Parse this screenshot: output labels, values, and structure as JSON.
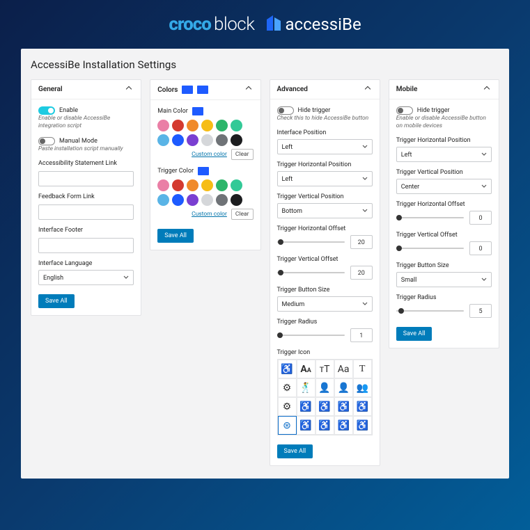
{
  "page_title": "AccessiBe Installation Settings",
  "logos": {
    "croco": "croco",
    "block": "block",
    "accessibe": "accessiBe"
  },
  "general": {
    "heading": "General",
    "enable_label": "Enable",
    "enable_desc": "Enable or disable AccessiBe integration script",
    "manual_label": "Manual Mode",
    "manual_desc": "Paste installation script manually",
    "accessibility_link_label": "Accessibility Statement Link",
    "feedback_link_label": "Feedback Form Link",
    "footer_label": "Interface Footer",
    "language_label": "Interface Language",
    "language_value": "English",
    "save": "Save All"
  },
  "colors": {
    "heading": "Colors",
    "header_chips": [
      "#1e5bff",
      "#1e5bff"
    ],
    "main_label": "Main Color",
    "main_chip": "#1e5bff",
    "trigger_label": "Trigger Color",
    "trigger_chip": "#1e5bff",
    "palette": [
      "#ea7fa6",
      "#d43a2f",
      "#f08a2b",
      "#f6bd16",
      "#2db56a",
      "#33c997",
      "#5ab4e6",
      "#1e5bff",
      "#7a3fd1",
      "#d5d7da",
      "#6f7377",
      "#1c1d1f"
    ],
    "custom_link": "Custom color",
    "clear": "Clear",
    "save": "Save All"
  },
  "advanced": {
    "heading": "Advanced",
    "hide_label": "Hide trigger",
    "hide_desc": "Check this to hide AccessiBe button",
    "interface_pos_label": "Interface Position",
    "interface_pos_value": "Left",
    "th_pos_label": "Trigger Horizontal Position",
    "th_pos_value": "Left",
    "tv_pos_label": "Trigger Vertical Position",
    "tv_pos_value": "Bottom",
    "th_off_label": "Trigger Horizontal Offset",
    "th_off_value": "20",
    "tv_off_label": "Trigger Vertical Offset",
    "tv_off_value": "20",
    "size_label": "Trigger Button Size",
    "size_value": "Medium",
    "radius_label": "Trigger Radius",
    "radius_value": "1",
    "icon_label": "Trigger Icon",
    "save": "Save All"
  },
  "mobile": {
    "heading": "Mobile",
    "hide_label": "Hide trigger",
    "hide_desc": "Enable or disable AccessiBe button on mobile devices",
    "th_pos_label": "Trigger Horizontal Position",
    "th_pos_value": "Left",
    "tv_pos_label": "Trigger Vertical Position",
    "tv_pos_value": "Center",
    "th_off_label": "Trigger Horizontal Offset",
    "th_off_value": "0",
    "tv_off_label": "Trigger Vertical Offset",
    "tv_off_value": "0",
    "size_label": "Trigger Button Size",
    "size_value": "Small",
    "radius_label": "Trigger Radius",
    "radius_value": "5",
    "save": "Save All"
  }
}
